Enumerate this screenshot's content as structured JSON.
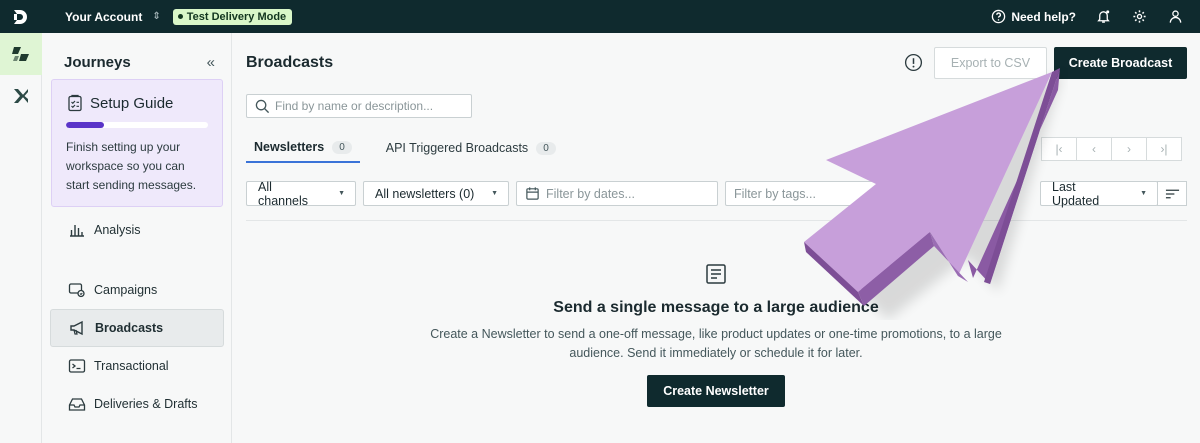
{
  "topbar": {
    "account_label": "Your Account",
    "mode_badge": "Test Delivery Mode",
    "help_label": "Need help?"
  },
  "sidebar": {
    "title": "Journeys",
    "setup": {
      "title": "Setup Guide",
      "progress": 0.27,
      "text": "Finish setting up your workspace so you can start sending messages."
    },
    "items": [
      {
        "label": "Analysis"
      },
      {
        "label": "Campaigns"
      },
      {
        "label": "Broadcasts"
      },
      {
        "label": "Transactional"
      },
      {
        "label": "Deliveries & Drafts"
      }
    ]
  },
  "main": {
    "title": "Broadcasts",
    "export_label": "Export to CSV",
    "create_label": "Create Broadcast",
    "search_placeholder": "Find by name or description...",
    "tabs": [
      {
        "label": "Newsletters",
        "count": "0"
      },
      {
        "label": "API Triggered Broadcasts",
        "count": "0"
      }
    ],
    "filters": {
      "channels": "All channels",
      "newsletters": "All newsletters (0)",
      "dates_placeholder": "Filter by dates...",
      "tags_placeholder": "Filter by tags...",
      "sort": "Last Updated"
    },
    "empty": {
      "heading": "Send a single message to a large audience",
      "text": "Create a Newsletter to send a one-off message, like product updates or one-time promotions, to a large audience. Send it immediately or schedule it for later.",
      "button": "Create Newsletter"
    }
  },
  "colors": {
    "topbar": "#0f2a2e",
    "badge": "#d9f7c9",
    "setup_bg": "#efe9fb",
    "progress": "#5a34c8",
    "arrow": "#c39ad6",
    "tab_active": "#3a73d8"
  }
}
